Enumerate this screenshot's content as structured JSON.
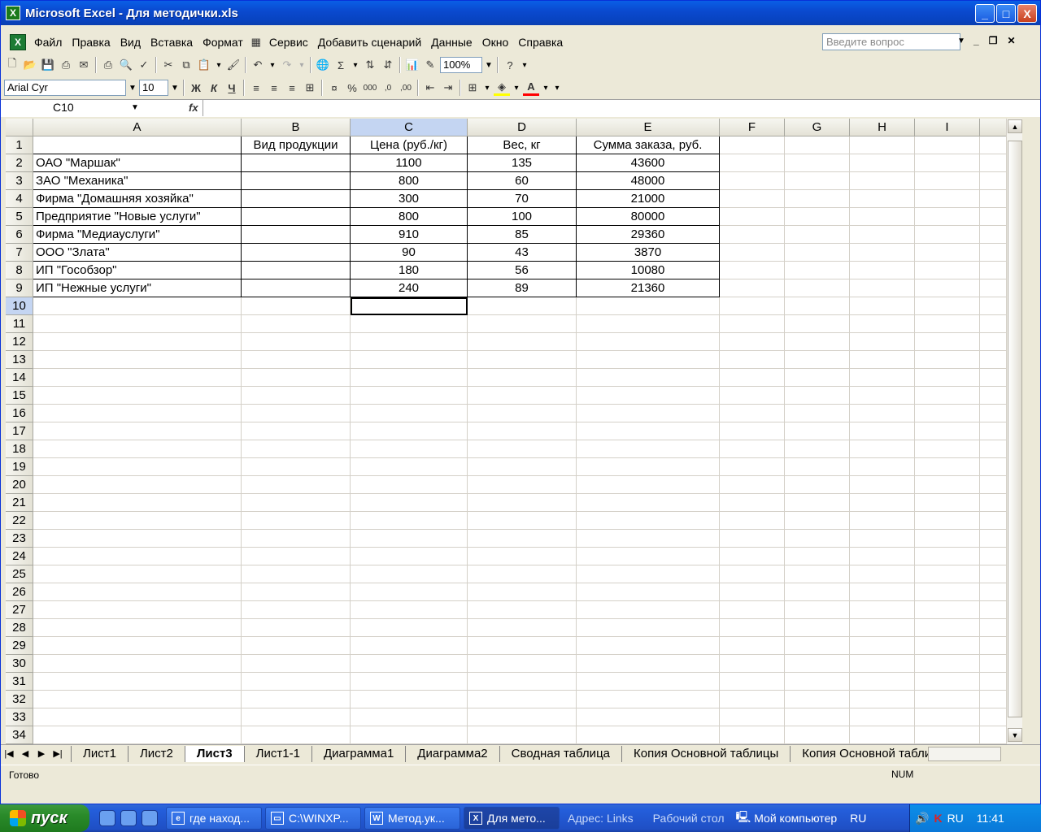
{
  "window": {
    "title": "Microsoft Excel - Для методички.xls",
    "min_label": "_",
    "max_label": "□",
    "close_label": "X"
  },
  "menu": {
    "items": [
      "Файл",
      "Правка",
      "Вид",
      "Вставка",
      "Формат",
      "Сервис",
      "Добавить сценарий",
      "Данные",
      "Окно",
      "Справка"
    ],
    "help_placeholder": "Введите вопрос"
  },
  "toolbar": {
    "zoom": "100%",
    "font": "Arial Cyr",
    "size": "10",
    "bold": "Ж",
    "italic": "К",
    "underline": "Ч"
  },
  "formula": {
    "name_box": "C10",
    "fx": "fx",
    "value": ""
  },
  "columns": [
    "A",
    "B",
    "C",
    "D",
    "E",
    "F",
    "G",
    "H",
    "I"
  ],
  "selected_column": "C",
  "selected_row": "10",
  "table": {
    "header": [
      "",
      "Вид продукции",
      "Цена (руб./кг)",
      "Вес, кг",
      "Сумма заказа, руб."
    ],
    "rows": [
      [
        "ОАО \"Маршак\"",
        "",
        "1100",
        "135",
        "43600"
      ],
      [
        "ЗАО \"Механика\"",
        "",
        "800",
        "60",
        "48000"
      ],
      [
        "Фирма \"Домашняя хозяйка\"",
        "",
        "300",
        "70",
        "21000"
      ],
      [
        "Предприятие \"Новые услуги\"",
        "",
        "800",
        "100",
        "80000"
      ],
      [
        "Фирма \"Медиауслуги\"",
        "",
        "910",
        "85",
        "29360"
      ],
      [
        "ООО \"Злата\"",
        "",
        "90",
        "43",
        "3870"
      ],
      [
        "ИП \"Гособзор\"",
        "",
        "180",
        "56",
        "10080"
      ],
      [
        "ИП \"Нежные услуги\"",
        "",
        "240",
        "89",
        "21360"
      ]
    ]
  },
  "row_numbers": [
    "1",
    "2",
    "3",
    "4",
    "5",
    "6",
    "7",
    "8",
    "9",
    "10",
    "11",
    "12",
    "13",
    "14",
    "15",
    "16",
    "17",
    "18",
    "19",
    "20",
    "21",
    "22",
    "23",
    "24",
    "25",
    "26",
    "27",
    "28",
    "29",
    "30",
    "31",
    "32",
    "33",
    "34"
  ],
  "sheets": {
    "tabs": [
      "Лист1",
      "Лист2",
      "Лист3",
      "Лист1-1",
      "Диаграмма1",
      "Диаграмма2",
      "Сводная таблица",
      "Копия Основной таблицы",
      "Копия Основной таблицы"
    ],
    "active": "Лист3"
  },
  "status": {
    "left": "Готово",
    "num": "NUM"
  },
  "taskbar": {
    "start": "пуск",
    "buttons": [
      {
        "label": "где наход...",
        "icon": "e"
      },
      {
        "label": "C:\\WINXP...",
        "icon": "▭"
      },
      {
        "label": "Метод.ук...",
        "icon": "W"
      },
      {
        "label": "Для мето...",
        "icon": "X"
      }
    ],
    "address": "Адрес:",
    "links": "Links",
    "desktop": "Рабочий стол",
    "my_computer": "Мой компьютер",
    "lang": "RU",
    "tray_lang": "RU",
    "time": "11:41"
  }
}
